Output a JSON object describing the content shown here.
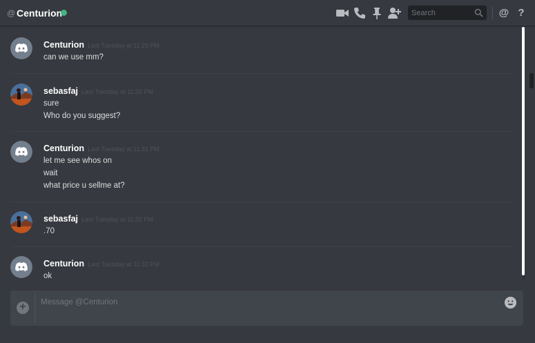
{
  "header": {
    "at_symbol": "@",
    "title": "Centurion",
    "status_color": "#43b581",
    "icons": [
      "video-call-icon",
      "voice-call-icon",
      "pin-icon",
      "add-friend-icon",
      "mention-icon",
      "help-icon"
    ],
    "help_glyph": "?",
    "mention_glyph": "@"
  },
  "search": {
    "placeholder": "Search"
  },
  "messages": [
    {
      "author": "Centurion",
      "avatar": "discord-default-avatar",
      "timestamp": "Last Tuesday at 11:29 PM",
      "lines": [
        "can we use mm?"
      ]
    },
    {
      "author": "sebasfaj",
      "avatar": "sebasfaj-avatar",
      "timestamp": "Last Tuesday at 11:30 PM",
      "lines": [
        "sure",
        "Who do you suggest?"
      ]
    },
    {
      "author": "Centurion",
      "avatar": "discord-default-avatar",
      "timestamp": "Last Tuesday at 11:31 PM",
      "lines": [
        "let me see whos on",
        "wait",
        "what price u sellme at?"
      ]
    },
    {
      "author": "sebasfaj",
      "avatar": "sebasfaj-avatar",
      "timestamp": "Last Tuesday at 11:32 PM",
      "lines": [
        ".70"
      ]
    },
    {
      "author": "Centurion",
      "avatar": "discord-default-avatar",
      "timestamp": "Last Tuesday at 11:32 PM",
      "lines": [
        "ok"
      ]
    }
  ],
  "composer": {
    "placeholder": "Message @Centurion",
    "add_glyph": "+"
  },
  "colors": {
    "background": "#36393f",
    "composer": "#40444b",
    "online": "#43b581",
    "blurple": "#7289da"
  }
}
